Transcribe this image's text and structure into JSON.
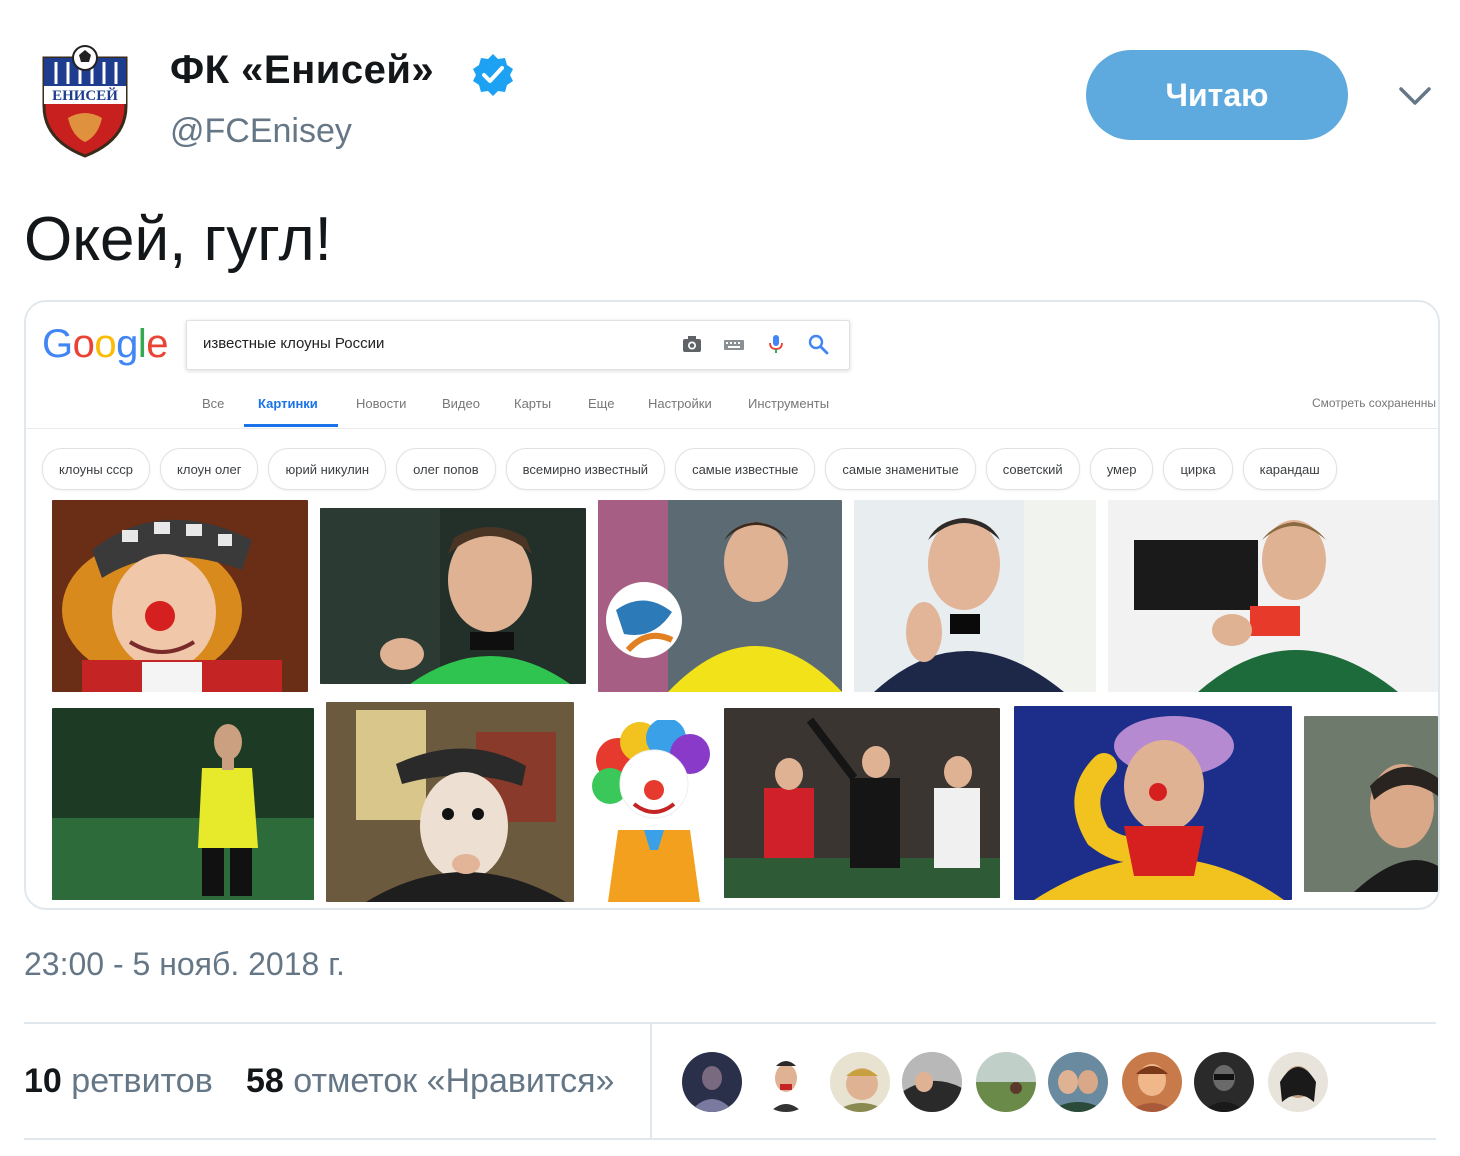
{
  "account": {
    "display_name": "ФК «Енисей»",
    "handle": "@FCEnisey",
    "logo_text": "ЕНИСЕЙ",
    "verified": true
  },
  "follow_button": {
    "label": "Читаю"
  },
  "tweet": {
    "text": "Окей, гугл!",
    "timestamp": "23:00 - 5 нояб. 2018 г."
  },
  "google": {
    "logo_letters": [
      {
        "ch": "G",
        "color": "#4285f4"
      },
      {
        "ch": "o",
        "color": "#ea4335"
      },
      {
        "ch": "o",
        "color": "#fbbc05"
      },
      {
        "ch": "g",
        "color": "#4285f4"
      },
      {
        "ch": "l",
        "color": "#34a853"
      },
      {
        "ch": "e",
        "color": "#ea4335"
      }
    ],
    "search_query": "известные клоуны России",
    "tabs": [
      "Все",
      "Картинки",
      "Новости",
      "Видео",
      "Карты",
      "Еще",
      "Настройки",
      "Инструменты"
    ],
    "active_tab": "Картинки",
    "saved_link": "Смотреть сохраненны",
    "chips": [
      "клоуны ссср",
      "клоун олег",
      "юрий никулин",
      "олег попов",
      "всемирно известный",
      "самые известные",
      "самые знаменитые",
      "советский",
      "умер",
      "цирка",
      "карандаш"
    ]
  },
  "stats": {
    "retweets_count": "10",
    "retweets_label": "ретвитов",
    "likes_count": "58",
    "likes_label": "отметок «Нравится»"
  },
  "colors": {
    "accent": "#5ea9dd",
    "verified": "#1da1f2",
    "muted_text": "#657786"
  }
}
